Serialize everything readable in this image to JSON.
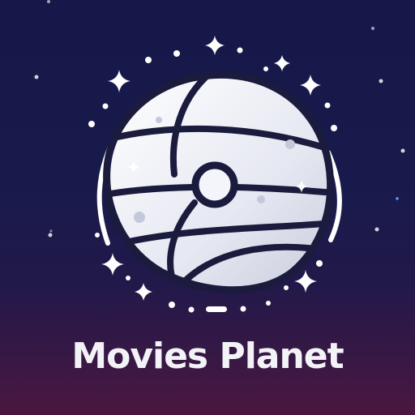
{
  "app": {
    "title": "Movies Planet"
  },
  "logo": {
    "icon": "planet-icon"
  },
  "colors": {
    "background_top": "#16184a",
    "background_bottom": "#4b1740",
    "planet_fill": "#eceef6",
    "planet_outline": "#1a1b3d",
    "sparkle": "#ffffff",
    "title_text": "#f3f3f7"
  }
}
